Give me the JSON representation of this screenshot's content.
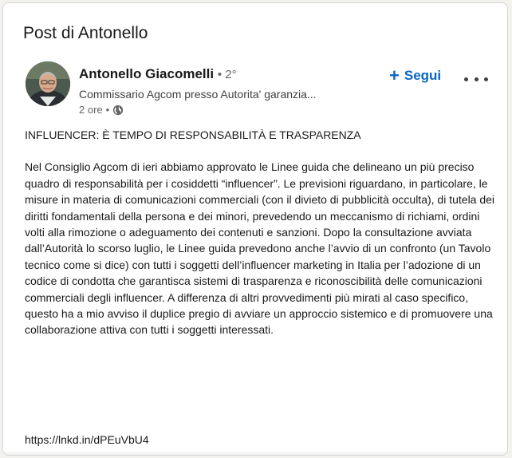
{
  "card": {
    "title": "Post di Antonello"
  },
  "author": {
    "name": "Antonello Giacomelli",
    "degree": "• 2°",
    "headline": "Commissario Agcom presso Autorita' garanzia...",
    "time": "2 ore",
    "visibility_icon": "globe-icon"
  },
  "actions": {
    "follow_label": "Segui",
    "follow_icon": "plus-icon",
    "more_icon": "more-options-icon"
  },
  "post": {
    "heading": "INFLUENCER: È TEMPO DI RESPONSABILITÀ E TRASPARENZA",
    "body": "Nel Consiglio Agcom di ieri abbiamo approvato le Linee guida che delineano un più preciso quadro di responsabilità per i cosiddetti “influencer”. Le previsioni riguardano, in particolare, le misure in materia di comunicazioni commerciali (con il divieto di pubblicità occulta), di tutela dei diritti fondamentali della persona e dei minori, prevedendo un meccanismo di richiami, ordini volti alla rimozione o adeguamento dei contenuti e sanzioni. Dopo la consultazione avviata dall’Autorità lo scorso luglio, le Linee guida prevedono anche l’avvio di un confronto (un Tavolo tecnico come si dice) con tutti i soggetti dell’influencer marketing in Italia per l’adozione di un codice di condotta che garantisca sistemi di trasparenza e riconoscibilità delle comunicazioni commerciali degli influencer. A differenza di altri provvedimenti più mirati al caso specifico, questo ha a mio avviso il duplice pregio di avviare un approccio sistemico e di promuovere una collaborazione attiva con tutti i soggetti interessati.",
    "link": "https://lnkd.in/dPEuVbU4"
  },
  "colors": {
    "accent": "#0a66c2",
    "text": "#191919",
    "secondary": "#666666"
  }
}
